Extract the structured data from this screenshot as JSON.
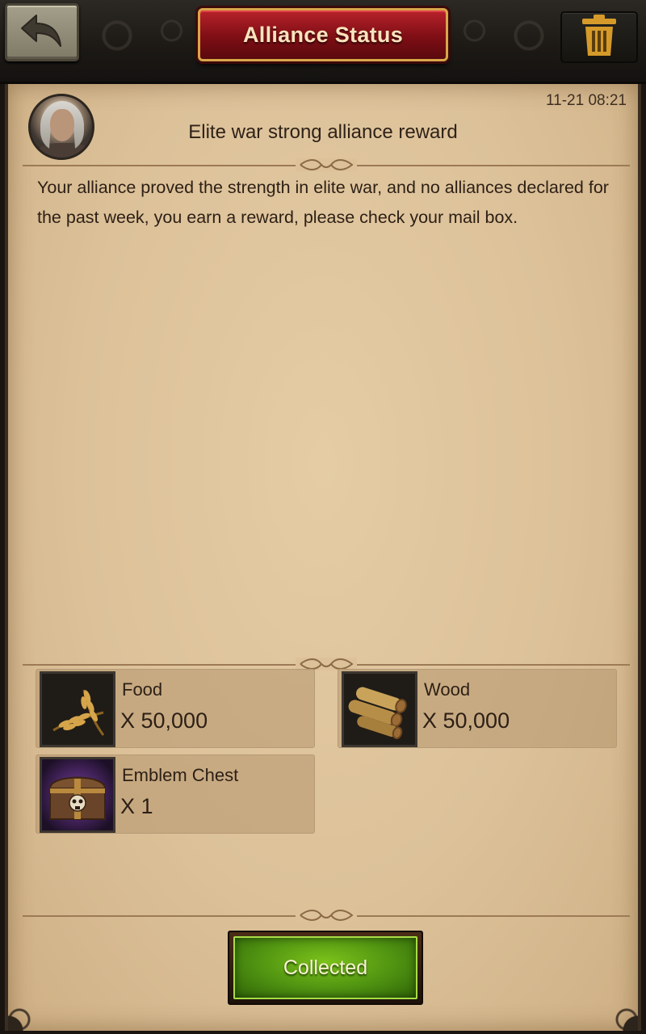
{
  "header": {
    "title": "Alliance Status",
    "back_icon": "back-arrow-icon",
    "trash_icon": "trash-icon"
  },
  "mail": {
    "timestamp": "11-21 08:21",
    "subject": "Elite war strong alliance reward",
    "body": "Your alliance proved the strength in elite war, and no alliances declared for the past week, you earn a reward, please check your mail box.",
    "sender_avatar": "elder-portrait"
  },
  "rewards": [
    {
      "name": "Food",
      "quantity": "X 50,000",
      "icon": "wheat-icon"
    },
    {
      "name": "Wood",
      "quantity": "X 50,000",
      "icon": "logs-icon"
    },
    {
      "name": "Emblem Chest",
      "quantity": "X 1",
      "icon": "chest-icon"
    }
  ],
  "action": {
    "label": "Collected"
  },
  "colors": {
    "title_banner": "#8f141b",
    "parchment": "#dcc199",
    "button_green": "#5a9d12",
    "text": "#2c1f15"
  }
}
